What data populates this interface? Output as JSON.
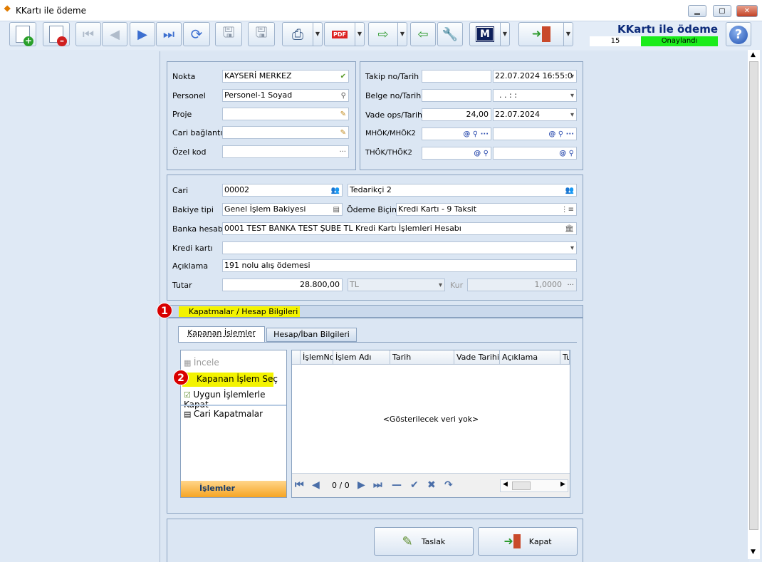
{
  "window": {
    "title": "KKartı ile ödeme"
  },
  "header": {
    "app_name": "KKartı ile ödeme",
    "record_no": "15",
    "status": "Onaylandı",
    "status_color": "#1bec1b"
  },
  "icons": {
    "new": "new-document-icon",
    "delete": "delete-document-icon",
    "first": "first-record-icon",
    "prev": "previous-record-icon",
    "next": "next-record-icon",
    "last": "last-record-icon",
    "refresh": "refresh-icon",
    "save": "save-icon",
    "save_close": "save-close-icon",
    "print": "printer-icon",
    "pdf": "pdf-icon",
    "export": "export-icon",
    "import": "import-icon",
    "tools": "wrench-icon",
    "m": "m-logo-icon",
    "exit": "exit-door-icon",
    "help": "help-icon"
  },
  "left_group": {
    "nokta_label": "Nokta",
    "nokta_value": "KAYSERİ MERKEZ",
    "personel_label": "Personel",
    "personel_value": "Personel-1 Soyad",
    "proje_label": "Proje",
    "proje_value": "",
    "cari_baglanti_label": "Cari bağlantı",
    "cari_baglanti_value": "",
    "ozel_kod_label": "Özel kod",
    "ozel_kod_value": "",
    "ellipsis": "···"
  },
  "right_group": {
    "takip_label": "Takip no/Tarih",
    "takip_no": "",
    "takip_tarih": "22.07.2024 16:55:0",
    "belge_label": "Belge no/Tarih",
    "belge_no": "",
    "belge_tarih": ".  .     :  :",
    "vade_label": "Vade ops/Tarih",
    "vade_ops": "24,00",
    "vade_tarih": "22.07.2024",
    "mhok_label": "MHÖK/MHÖK2",
    "thok_label": "THÖK/THÖK2",
    "at": "@"
  },
  "cari_group": {
    "cari_label": "Cari",
    "cari_code": "00002",
    "cari_name": "Tedarikçi 2",
    "bakiye_label": "Bakiye tipi",
    "bakiye_value": "Genel İşlem Bakiyesi",
    "odeme_label": "Ödeme Biçimi",
    "odeme_value": "Kredi Kartı - 9 Taksit",
    "banka_label": "Banka hesabı",
    "banka_value": "0001 TEST BANKA TEST ŞUBE TL Kredi Kartı İşlemleri Hesabı",
    "kredi_label": "Kredi kartı",
    "kredi_value": "",
    "aciklama_label": "Açıklama",
    "aciklama_value": "191 nolu alış ödemesi",
    "tutar_label": "Tutar",
    "tutar_value": "28.800,00",
    "currency": "TL",
    "kur_label": "Kur",
    "kur_value": "1,0000"
  },
  "section": {
    "header": "Kapatmalar / Hesap Bilgileri",
    "callout_1": "1",
    "callout_2": "2"
  },
  "tabs": [
    {
      "label": "Kapanan İşlemler"
    },
    {
      "label": "Hesap/İban Bilgileri"
    }
  ],
  "actions": {
    "items": [
      {
        "label": "İncele"
      },
      {
        "label": "Kapanan İşlem Seç"
      },
      {
        "label": "Uygun İşlemlerle Kapat"
      },
      {
        "label": "Cari Kapatmalar"
      }
    ],
    "footer": "İşlemler"
  },
  "grid": {
    "columns": [
      "İşlemNo",
      "İşlem Adı",
      "Tarih",
      "Vade Tarihi",
      "Açıklama",
      "Tu"
    ],
    "empty_text": "<Gösterilecek veri yok>",
    "pager": "0 / 0"
  },
  "buttons": {
    "taslak": "Taslak",
    "kapat": "Kapat"
  }
}
